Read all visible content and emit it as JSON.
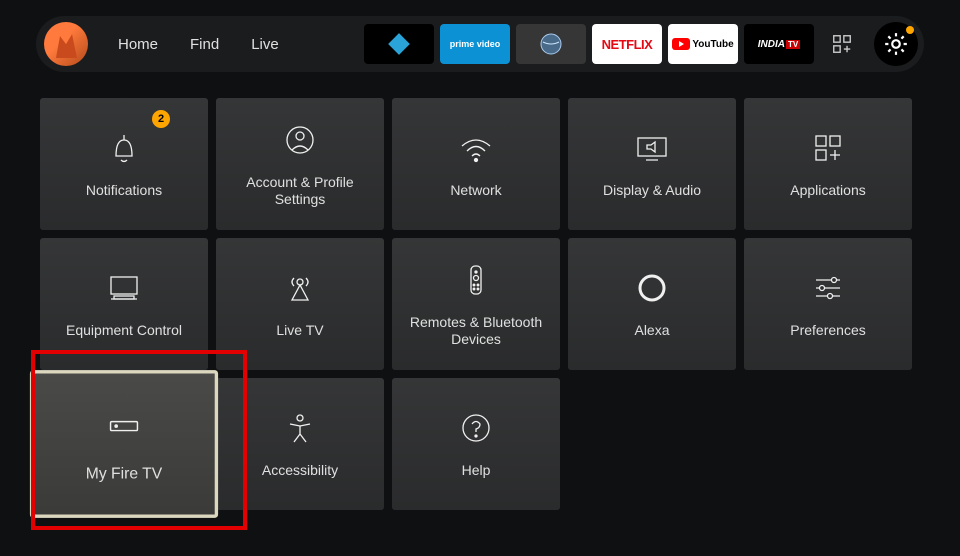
{
  "nav": {
    "home": "Home",
    "find": "Find",
    "live": "Live"
  },
  "appTiles": {
    "prime": "prime video",
    "netflix": "NETFLIX",
    "youtube": "YouTube",
    "india": "INDIA"
  },
  "notify_badge": "2",
  "tiles": {
    "notifications": "Notifications",
    "account": "Account & Profile Settings",
    "network": "Network",
    "display": "Display & Audio",
    "applications": "Applications",
    "equipment": "Equipment Control",
    "livetv": "Live TV",
    "remotes": "Remotes & Bluetooth Devices",
    "alexa": "Alexa",
    "preferences": "Preferences",
    "myfire": "My Fire TV",
    "accessibility": "Accessibility",
    "help": "Help"
  }
}
